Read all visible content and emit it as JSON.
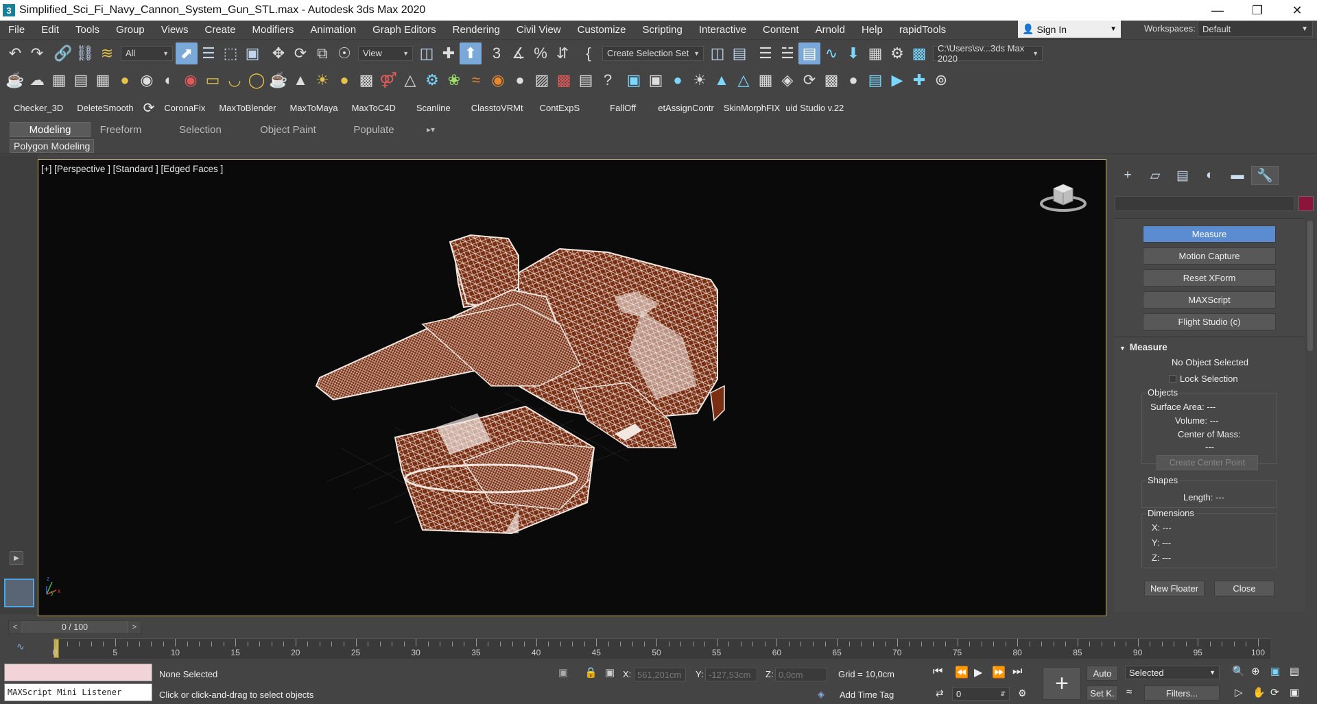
{
  "window": {
    "title": "Simplified_Sci_Fi_Navy_Cannon_System_Gun_STL.max - Autodesk 3ds Max 2020",
    "app_icon": "3",
    "minimize": "—",
    "maximize": "❐",
    "close": "✕"
  },
  "menu": {
    "items": [
      "File",
      "Edit",
      "Tools",
      "Group",
      "Views",
      "Create",
      "Modifiers",
      "Animation",
      "Graph Editors",
      "Rendering",
      "Civil View",
      "Customize",
      "Scripting",
      "Interactive",
      "Content",
      "Arnold",
      "Help",
      "rapidTools"
    ]
  },
  "account": {
    "signin": "Sign In",
    "workspaces_label": "Workspaces:",
    "workspace": "Default"
  },
  "toolbar": {
    "filter": "All",
    "ref_coord": "View",
    "selection_set": "Create Selection Set",
    "project_path": "C:\\Users\\sv...3ds Max 2020"
  },
  "shortcuts": [
    "Checker_3D",
    "DeleteSmooth",
    "CoronaFix",
    "MaxToBlender",
    "MaxToMaya",
    "MaxToC4D",
    "Scanline",
    "ClasstoVRMt",
    "ContExpS",
    "FallOff",
    "etAssignContr",
    "SkinMorphFIX",
    "uid Studio v.22"
  ],
  "ribbon": {
    "tabs": [
      "Modeling",
      "Freeform",
      "Selection",
      "Object Paint",
      "Populate"
    ],
    "active": "Modeling",
    "sub": "Polygon Modeling"
  },
  "viewport": {
    "label": "[+] [Perspective ] [Standard ] [Edged Faces ]",
    "axis_z": "z",
    "axis_x": "x",
    "axis_y": "y"
  },
  "utilities": {
    "buttons": [
      "Measure",
      "Motion Capture",
      "Reset XForm",
      "MAXScript",
      "Flight Studio (c)"
    ],
    "active": "Measure"
  },
  "measure": {
    "title": "Measure",
    "status": "No Object Selected",
    "lock": "Lock Selection",
    "objects_label": "Objects",
    "surface_area": "Surface Area: ---",
    "volume": "Volume: ---",
    "center_of_mass": "Center of Mass:",
    "center_value": "---",
    "create_center": "Create Center Point",
    "shapes_label": "Shapes",
    "length": "Length: ---",
    "dimensions_label": "Dimensions",
    "x": "X:  ---",
    "y": "Y:  ---",
    "z": "Z:  ---",
    "new_floater": "New Floater",
    "close": "Close"
  },
  "timeline": {
    "frame": "0 / 100",
    "ticks": [
      "0",
      "5",
      "10",
      "15",
      "20",
      "25",
      "30",
      "35",
      "40",
      "45",
      "50",
      "55",
      "60",
      "65",
      "70",
      "75",
      "80",
      "85",
      "90",
      "95",
      "100"
    ]
  },
  "status": {
    "listener": "MAXScript Mini Listener",
    "selection": "None Selected",
    "prompt": "Click or click-and-drag to select objects",
    "x_label": "X:",
    "x_val": "561,201cm",
    "y_label": "Y:",
    "y_val": "-127,53cm",
    "z_label": "Z:",
    "z_val": "0,0cm",
    "grid": "Grid = 10,0cm",
    "add_time_tag": "Add Time Tag",
    "auto": "Auto",
    "setk": "Set K.",
    "key_filter": "Selected",
    "filters": "Filters...",
    "frame_field": "0"
  },
  "colors": {
    "accent": "#5b8cd1",
    "model_fill": "#7a2e12",
    "wire": "#f1e6e0",
    "swatch": "#8b1538"
  }
}
